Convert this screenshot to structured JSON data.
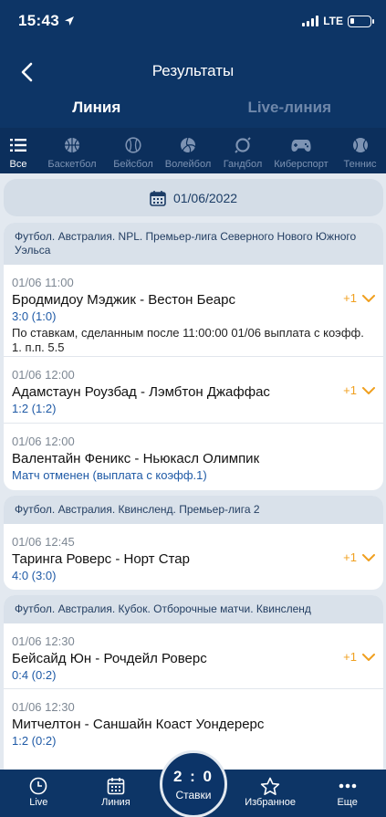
{
  "status": {
    "time": "15:43",
    "network": "LTE"
  },
  "header": {
    "title": "Результаты",
    "back_icon": "chevron-left-icon"
  },
  "tabs": [
    {
      "label": "Линия",
      "active": true
    },
    {
      "label": "Live-линия",
      "active": false
    }
  ],
  "sports": [
    {
      "label": "Все",
      "icon": "list-icon",
      "active": true
    },
    {
      "label": "Баскетбол",
      "icon": "basketball-icon",
      "active": false
    },
    {
      "label": "Бейсбол",
      "icon": "baseball-icon",
      "active": false
    },
    {
      "label": "Волейбол",
      "icon": "volleyball-icon",
      "active": false
    },
    {
      "label": "Гандбол",
      "icon": "handball-icon",
      "active": false
    },
    {
      "label": "Киберспорт",
      "icon": "gamepad-icon",
      "active": false
    },
    {
      "label": "Теннис",
      "icon": "tennis-icon",
      "active": false
    }
  ],
  "date": {
    "value": "01/06/2022",
    "icon": "calendar-icon"
  },
  "sections": [
    {
      "title": "Футбол. Австралия. NPL. Премьер-лига Северного Нового Южного Уэльса",
      "matches": [
        {
          "time": "01/06 11:00",
          "teams": "Бродмидоу Мэджик - Вестон Беарс",
          "score": "3:0 (1:0)",
          "note": "По ставкам, сделанным после 11:00:00 01/06 выплата с коэфф. 1. п.п. 5.5",
          "more": "+1"
        },
        {
          "time": "01/06 12:00",
          "teams": "Адамстаун Роузбад - Лэмбтон Джаффас",
          "score": "1:2 (1:2)",
          "more": "+1"
        },
        {
          "time": "01/06 12:00",
          "teams": "Валентайн Феникс - Ньюкасл Олимпик",
          "score": "Матч отменен (выплата с коэфф.1)"
        }
      ]
    },
    {
      "title": "Футбол. Австралия. Квинсленд. Премьер-лига 2",
      "matches": [
        {
          "time": "01/06 12:45",
          "teams": "Таринга Роверс - Норт Стар",
          "score": "4:0 (3:0)",
          "more": "+1"
        }
      ]
    },
    {
      "title": "Футбол. Австралия. Кубок. Отборочные матчи. Квинсленд",
      "matches": [
        {
          "time": "01/06 12:30",
          "teams": "Бейсайд Юн - Рочдейл Роверс",
          "score": "0:4 (0:2)",
          "more": "+1"
        },
        {
          "time": "01/06 12:30",
          "teams": "Митчелтон - Саншайн Коаст Уондерерс",
          "score": "1:2 (0:2)"
        }
      ]
    }
  ],
  "bottom_nav": {
    "live": "Live",
    "line": "Линия",
    "bets_score": "2 : 0",
    "bets_label": "Ставки",
    "favorites": "Избранное",
    "more": "Еще"
  },
  "colors": {
    "header_bg": "#0d3566",
    "accent": "#f0a020",
    "score": "#1f5aa6"
  }
}
